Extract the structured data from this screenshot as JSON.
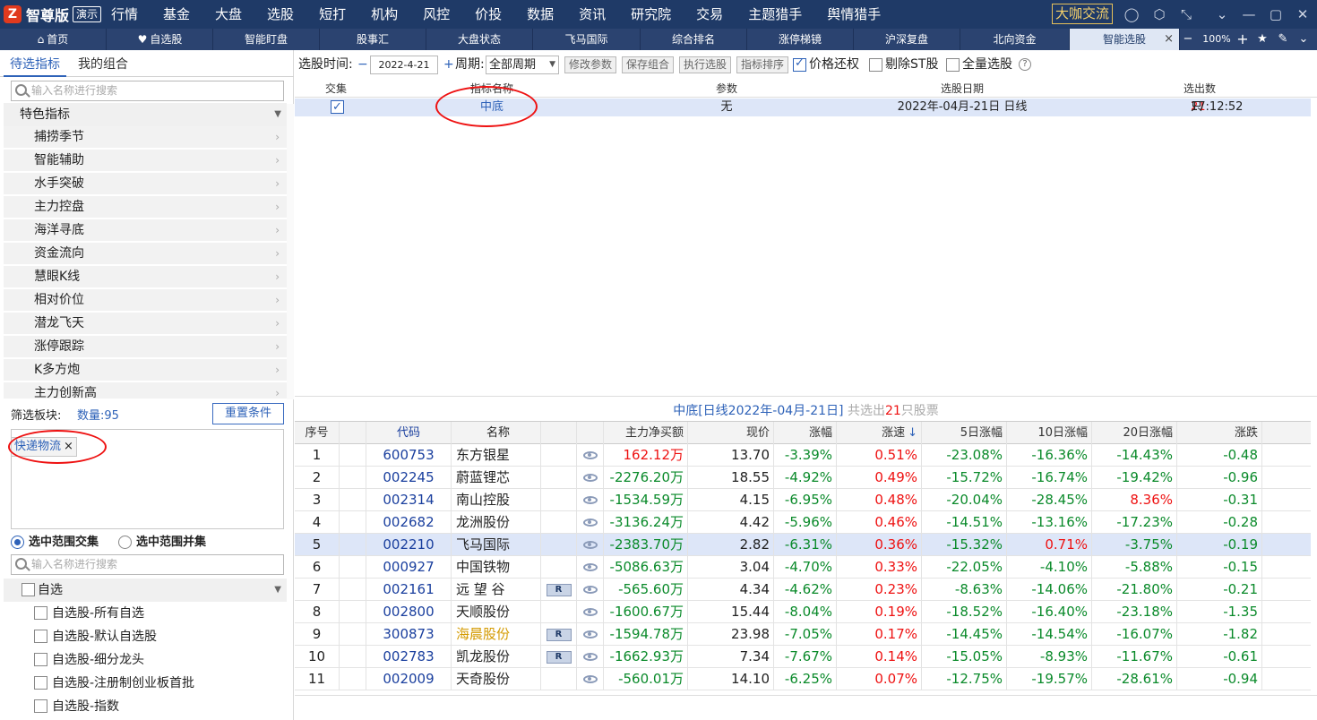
{
  "app": {
    "logo_text": "智尊版",
    "demo_label": "演示",
    "mark": "Z"
  },
  "main_menu": [
    "行情",
    "基金",
    "大盘",
    "选股",
    "短打",
    "机构",
    "风控",
    "价投",
    "数据",
    "资讯",
    "研究院",
    "交易",
    "主题猎手",
    "舆情猎手"
  ],
  "top_button": "大咖交流",
  "window_icons": [
    "user-icon",
    "settings-hex-icon",
    "collapse-icon",
    "chevron-down-icon",
    "minimize-icon",
    "maximize-icon",
    "close-icon"
  ],
  "tabs": [
    {
      "label": "首页",
      "icon": "home-icon"
    },
    {
      "label": "自选股",
      "icon": "heart-icon"
    },
    {
      "label": "智能盯盘"
    },
    {
      "label": "股事汇"
    },
    {
      "label": "大盘状态"
    },
    {
      "label": "飞马国际"
    },
    {
      "label": "综合排名"
    },
    {
      "label": "涨停梯镜"
    },
    {
      "label": "沪深复盘"
    },
    {
      "label": "北向资金"
    },
    {
      "label": "智能选股",
      "active": true
    }
  ],
  "tab_close": "×",
  "zoom": {
    "minus": "−",
    "value": "100%",
    "plus": "+"
  },
  "left": {
    "tabs": [
      "待选指标",
      "我的组合"
    ],
    "search_placeholder": "输入名称进行搜索",
    "tree_header": "特色指标",
    "tree_items": [
      "捕捞季节",
      "智能辅助",
      "水手突破",
      "主力控盘",
      "海洋寻底",
      "资金流向",
      "慧眼K线",
      "相对价位",
      "潜龙飞天",
      "涨停跟踪",
      "K多方炮",
      "主力创新高"
    ],
    "filter_label": "筛选板块:",
    "filter_count": "数量:95",
    "reset_button": "重置条件",
    "tag": "快递物流",
    "tag_close": "×",
    "radio1": "选中范围交集",
    "radio2": "选中范围并集",
    "search2_placeholder": "输入名称进行搜索",
    "zixuan_header": "自选",
    "zixuan_items": [
      "自选股-所有自选",
      "自选股-默认自选股",
      "自选股-细分龙头",
      "自选股-注册制创业板首批",
      "自选股-指数"
    ]
  },
  "toolbar": {
    "time_label": "选股时间:",
    "minus": "−",
    "date": "2022-4-21",
    "plus": "+",
    "period_label": "周期:",
    "period_value": "全部周期",
    "btn_modify": "修改参数",
    "btn_save": "保存组合",
    "btn_exec": "执行选股",
    "btn_sort": "指标排序",
    "cb_price": "价格还权",
    "cb_st": "剔除ST股",
    "cb_all": "全量选股",
    "help": "?"
  },
  "indicator_table": {
    "headers": [
      "交集",
      "指标名称",
      "参数",
      "选股日期",
      "选出数"
    ],
    "row": {
      "name": "中底",
      "param": "无",
      "date": "2022年-04月-21日 日线",
      "count": "21",
      "count_unit": "只",
      "time": "17:12:52"
    }
  },
  "result_title": {
    "prefix": "中底[日线2022年-04月-21日]",
    "mid": "共选出",
    "count": "21",
    "suffix": "只股票"
  },
  "result_headers": {
    "no": "序号",
    "code": "代码",
    "name": "名称",
    "net": "主力净买额",
    "price": "现价",
    "chg": "涨幅",
    "spd": "涨速",
    "d5": "5日涨幅",
    "d10": "10日涨幅",
    "d20": "20日涨幅",
    "zd": "涨跌",
    "sort_arrow": "↓"
  },
  "rows": [
    {
      "no": "1",
      "code": "600753",
      "name": "东方银星",
      "r": false,
      "net": "162.12万",
      "price": "13.70",
      "chg": "-3.39%",
      "spd": "0.51%",
      "d5": "-23.08%",
      "d10": "-16.36%",
      "d20": "-14.43%",
      "zd": "-0.48"
    },
    {
      "no": "2",
      "code": "002245",
      "name": "蔚蓝锂芯",
      "r": false,
      "net": "-2276.20万",
      "price": "18.55",
      "chg": "-4.92%",
      "spd": "0.49%",
      "d5": "-15.72%",
      "d10": "-16.74%",
      "d20": "-19.42%",
      "zd": "-0.96"
    },
    {
      "no": "3",
      "code": "002314",
      "name": "南山控股",
      "r": false,
      "net": "-1534.59万",
      "price": "4.15",
      "chg": "-6.95%",
      "spd": "0.48%",
      "d5": "-20.04%",
      "d10": "-28.45%",
      "d20": "8.36%",
      "zd": "-0.31"
    },
    {
      "no": "4",
      "code": "002682",
      "name": "龙洲股份",
      "r": false,
      "net": "-3136.24万",
      "price": "4.42",
      "chg": "-5.96%",
      "spd": "0.46%",
      "d5": "-14.51%",
      "d10": "-13.16%",
      "d20": "-17.23%",
      "zd": "-0.28"
    },
    {
      "no": "5",
      "code": "002210",
      "name": "飞马国际",
      "r": false,
      "net": "-2383.70万",
      "price": "2.82",
      "chg": "-6.31%",
      "spd": "0.36%",
      "d5": "-15.32%",
      "d10": "0.71%",
      "d20": "-3.75%",
      "zd": "-0.19"
    },
    {
      "no": "6",
      "code": "000927",
      "name": "中国铁物",
      "r": false,
      "net": "-5086.63万",
      "price": "3.04",
      "chg": "-4.70%",
      "spd": "0.33%",
      "d5": "-22.05%",
      "d10": "-4.10%",
      "d20": "-5.88%",
      "zd": "-0.15"
    },
    {
      "no": "7",
      "code": "002161",
      "name": "远 望 谷",
      "r": true,
      "net": "-565.60万",
      "price": "4.34",
      "chg": "-4.62%",
      "spd": "0.23%",
      "d5": "-8.63%",
      "d10": "-14.06%",
      "d20": "-21.80%",
      "zd": "-0.21"
    },
    {
      "no": "8",
      "code": "002800",
      "name": "天顺股份",
      "r": false,
      "net": "-1600.67万",
      "price": "15.44",
      "chg": "-8.04%",
      "spd": "0.19%",
      "d5": "-18.52%",
      "d10": "-16.40%",
      "d20": "-23.18%",
      "zd": "-1.35"
    },
    {
      "no": "9",
      "code": "300873",
      "name": "海晨股份",
      "r": true,
      "net": "-1594.78万",
      "price": "23.98",
      "chg": "-7.05%",
      "spd": "0.17%",
      "d5": "-14.45%",
      "d10": "-14.54%",
      "d20": "-16.07%",
      "zd": "-1.82"
    },
    {
      "no": "10",
      "code": "002783",
      "name": "凯龙股份",
      "r": true,
      "net": "-1662.93万",
      "price": "7.34",
      "chg": "-7.67%",
      "spd": "0.14%",
      "d5": "-15.05%",
      "d10": "-8.93%",
      "d20": "-11.67%",
      "zd": "-0.61"
    },
    {
      "no": "11",
      "code": "002009",
      "name": "天奇股份",
      "r": false,
      "net": "-560.01万",
      "price": "14.10",
      "chg": "-6.25%",
      "spd": "0.07%",
      "d5": "-12.75%",
      "d10": "-19.57%",
      "d20": "-28.61%",
      "zd": "-0.94"
    }
  ],
  "r_badge": "R",
  "colors": {
    "topbar": "#1f3a67",
    "tabbar": "#2b4370",
    "accent": "#2e62b8",
    "up": "#e11",
    "down": "#0a8a2a",
    "highlight": "#dde6f8",
    "gem": "#d49a00"
  }
}
